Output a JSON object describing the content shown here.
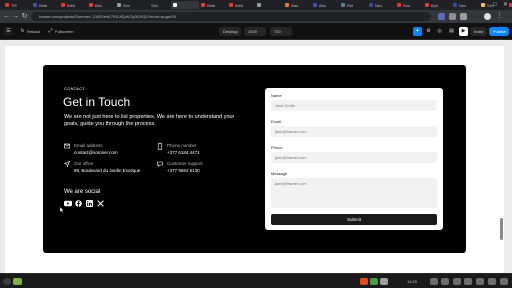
{
  "browser": {
    "tabs": [
      {
        "title": "TE!",
        "color": "#e53935"
      },
      {
        "title": "Web",
        "color": "#3f51b5"
      },
      {
        "title": "Web",
        "color": "#e53935"
      },
      {
        "title": "Bes",
        "color": "#e53935"
      },
      {
        "title": "Sch",
        "color": "#9e9e9e"
      },
      {
        "title": "Sch",
        "color": "#212121"
      },
      {
        "title": "",
        "color": "#ffffff",
        "active": true
      },
      {
        "title": "Web",
        "color": "#e53935"
      },
      {
        "title": "Web",
        "color": "#e53935"
      },
      {
        "title": "",
        "color": "#9e9e9e"
      },
      {
        "title": "Gas",
        "color": "#ff7043"
      },
      {
        "title": "Abo",
        "color": "#3f51b5"
      },
      {
        "title": "Ref",
        "color": "#607d8b"
      },
      {
        "title": "Neo",
        "color": "#3949ab"
      },
      {
        "title": "Sno",
        "color": "#e53935"
      },
      {
        "title": "Bph",
        "color": "#e53935"
      },
      {
        "title": "Neo",
        "color": "#3949ab"
      },
      {
        "title": "Sch",
        "color": "#fbc02d"
      },
      {
        "title": "Cat",
        "color": "#e53935"
      },
      {
        "title": "Cor",
        "color": "#6d4c41"
      },
      {
        "title": "Hor",
        "color": "#e53935"
      },
      {
        "title": "Mai",
        "color": "#fbc02d"
      },
      {
        "title": "",
        "color": "#9e9e9e"
      },
      {
        "title": "Bei",
        "color": "#43a047"
      },
      {
        "title": "Pos",
        "color": "#e53935"
      }
    ],
    "url": "framer.com/projects/Summer--Z4i0TæfK7RDJIQxKOy3DSQ0?node=augmS9"
  },
  "framer": {
    "reload": "Reload",
    "fullscreen": "Fullscreen",
    "device": "Desktop",
    "width": "1920",
    "height": "720",
    "invite": "Invite",
    "publish": "Publish"
  },
  "contact": {
    "eyebrow": "CONTACT",
    "heading": "Get in Touch",
    "subheading": "We are not just here to list properties. We are here to understand your goals, guide you through the process.",
    "email_label": "Email address",
    "email_value": "contact@somner.com",
    "phone_label": "Phone number",
    "phone_value": "+377 6184 4471",
    "office_label": "Our office",
    "office_value": "89, Boulevard du Jardin Exotique",
    "support_label": "Customer support",
    "support_value": "+377 9564 5130",
    "social_heading": "We are social",
    "social_icons": [
      "youtube-icon",
      "facebook-icon",
      "linkedin-icon",
      "x-icon"
    ]
  },
  "form": {
    "name_label": "Name",
    "name_placeholder": "Jade Smith",
    "email_label": "Email",
    "email_placeholder": "jane@framer.com",
    "phone_label": "Phone",
    "phone_placeholder": "jane@framer.com",
    "message_label": "Message",
    "message_placeholder": "jane@framer.com",
    "submit": "Submit"
  },
  "taskbar": {
    "time": "14:29"
  }
}
